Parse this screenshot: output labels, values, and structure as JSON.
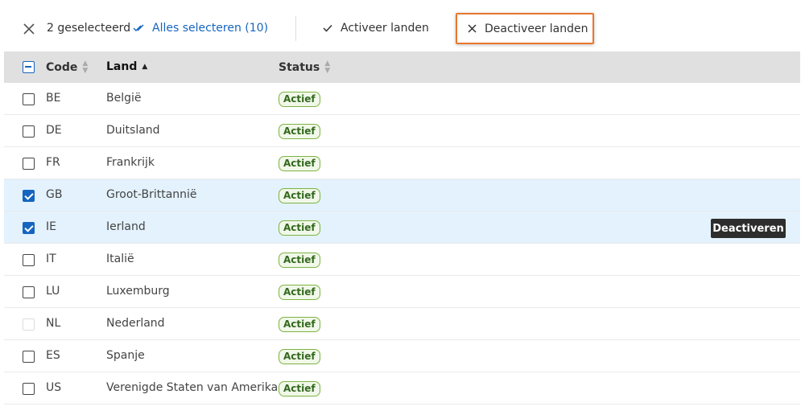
{
  "toolbar": {
    "selected_count": "2 geselecteerd",
    "select_all": "Alles selecteren (10)",
    "activate": "Activeer landen",
    "deactivate": "Deactiveer landen"
  },
  "table": {
    "columns": {
      "code": "Code",
      "land": "Land",
      "status": "Status"
    },
    "rows": [
      {
        "code": "BE",
        "land": "België",
        "status": "Actief",
        "checked": false
      },
      {
        "code": "DE",
        "land": "Duitsland",
        "status": "Actief",
        "checked": false
      },
      {
        "code": "FR",
        "land": "Frankrijk",
        "status": "Actief",
        "checked": false
      },
      {
        "code": "GB",
        "land": "Groot-Brittannië",
        "status": "Actief",
        "checked": true
      },
      {
        "code": "IE",
        "land": "Ierland",
        "status": "Actief",
        "checked": true
      },
      {
        "code": "IT",
        "land": "Italië",
        "status": "Actief",
        "checked": false
      },
      {
        "code": "LU",
        "land": "Luxemburg",
        "status": "Actief",
        "checked": false
      },
      {
        "code": "NL",
        "land": "Nederland",
        "status": "Actief",
        "checked": false
      },
      {
        "code": "ES",
        "land": "Spanje",
        "status": "Actief",
        "checked": false
      },
      {
        "code": "US",
        "land": "Verenigde Staten van Amerika",
        "status": "Actief",
        "checked": false
      }
    ]
  },
  "tooltip": {
    "text": "Deactiveren"
  },
  "colors": {
    "accent": "#1565c0",
    "highlight": "#e8772e",
    "badge_border": "#7cb342",
    "selected_row": "#e3f2fd"
  }
}
